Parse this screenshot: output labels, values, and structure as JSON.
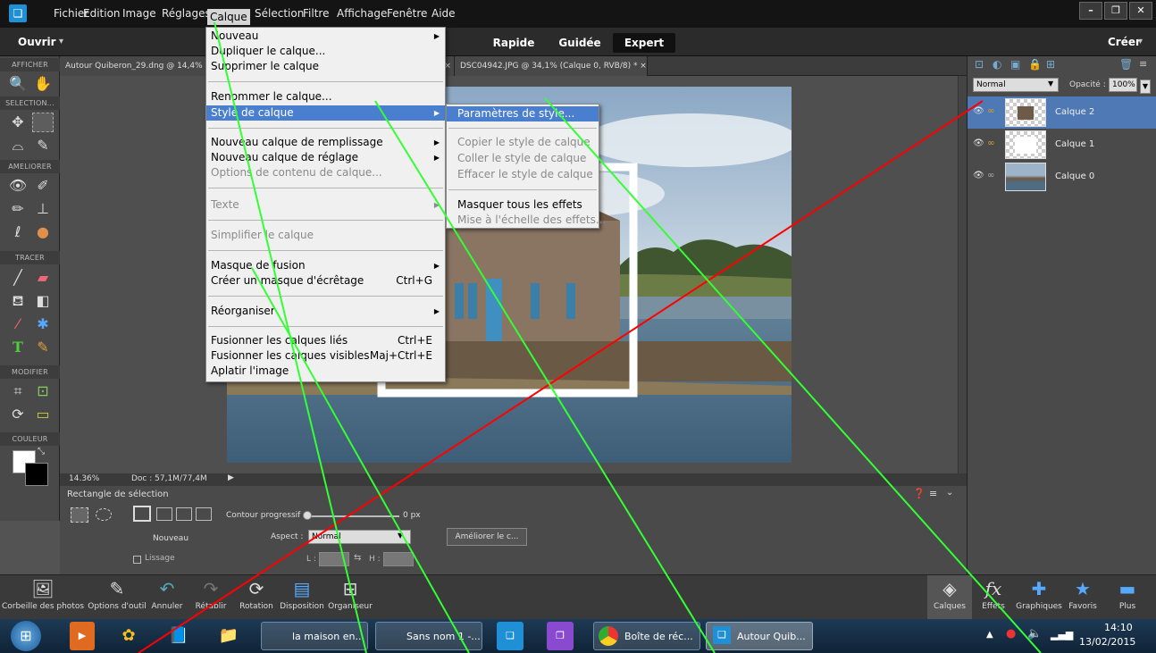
{
  "menubar": {
    "items": [
      "Fichier",
      "Edition",
      "Image",
      "Réglages",
      "Calque",
      "Sélection",
      "Filtre",
      "Affichage",
      "Fenêtre",
      "Aide"
    ],
    "window_controls": [
      "–",
      "❐",
      "✕"
    ]
  },
  "row2": {
    "open_label": "Ouvrir",
    "modes": [
      "Rapide",
      "Guidée",
      "Expert"
    ],
    "create_label": "Créer"
  },
  "toolbox": {
    "sections": [
      "AFFICHER",
      "SELECTION...",
      "AMELIORER",
      "TRACER",
      "MODIFIER",
      "COULEUR"
    ]
  },
  "tabs": [
    "Autour Quiberon_29.dng @ 14,4% (C",
    "* ×",
    "DSC04942.JPG @ 34,1% (Calque 0, RVB/8) * ×"
  ],
  "status": {
    "zoom": "14.36%",
    "doc": "Doc : 57,1M/77,4M"
  },
  "options": {
    "title": "Rectangle de sélection",
    "new_label": "Nouveau",
    "smooth_label": "Lissage",
    "feather_label": "Contour progressif :",
    "feather_value": "0 px",
    "aspect_label": "Aspect :",
    "aspect_value": "Normal",
    "refine_button": "Améliorer le c...",
    "l_label": "L :",
    "h_label": "H :"
  },
  "layers": {
    "blend_mode": "Normal",
    "opacity_label": "Opacité :",
    "opacity_value": "100%",
    "items": [
      {
        "name": "Calque 2"
      },
      {
        "name": "Calque 1"
      },
      {
        "name": "Calque 0"
      }
    ]
  },
  "calque_menu": {
    "items": [
      {
        "label": "Nouveau",
        "arrow": "▶",
        "disabled": false
      },
      {
        "label": "Dupliquer le calque...",
        "disabled": false
      },
      {
        "label": "Supprimer le calque",
        "disabled": false
      },
      {
        "label": "Renommer le calque...",
        "disabled": false
      },
      {
        "label": "Style de calque",
        "arrow": "▶",
        "highlighted": true
      },
      {
        "label": "Nouveau calque de remplissage",
        "arrow": "▶",
        "disabled": false
      },
      {
        "label": "Nouveau calque de réglage",
        "arrow": "▶",
        "disabled": false
      },
      {
        "label": "Options de contenu de calque...",
        "disabled": true
      },
      {
        "label": "Texte",
        "arrow": "▶",
        "disabled": true
      },
      {
        "label": "Simplifier le calque",
        "disabled": true
      },
      {
        "label": "Masque de fusion",
        "arrow": "▶",
        "disabled": false
      },
      {
        "label": "Créer un masque d'écrêtage",
        "shortcut": "Ctrl+G",
        "disabled": false
      },
      {
        "label": "Réorganiser",
        "arrow": "▶",
        "disabled": false
      },
      {
        "label": "Fusionner les calques liés",
        "shortcut": "Ctrl+E",
        "disabled": false
      },
      {
        "label": "Fusionner les calques visibles",
        "shortcut": "Maj+Ctrl+E",
        "disabled": false
      },
      {
        "label": "Aplatir l'image",
        "disabled": false
      }
    ]
  },
  "style_submenu": {
    "items": [
      {
        "label": "Paramètres de style...",
        "highlighted": true
      },
      {
        "label": "Copier le style de calque",
        "disabled": true
      },
      {
        "label": "Coller le style de calque",
        "disabled": true
      },
      {
        "label": "Effacer le style de calque",
        "disabled": true
      },
      {
        "label": "Masquer tous les effets",
        "disabled": false
      },
      {
        "label": "Mise à l'échelle des effets...",
        "disabled": true
      }
    ]
  },
  "bottom_panel": {
    "left": [
      "Corbeille des photos",
      "Options d'outil",
      "Annuler",
      "Rétablir",
      "Rotation",
      "Disposition",
      "Organiseur"
    ],
    "right": [
      "Calques",
      "Effets",
      "Graphiques",
      "Favoris",
      "Plus"
    ]
  },
  "taskbar": {
    "windows": [
      "la maison en...",
      "Sans nom 1 -...",
      "Boîte de réc...",
      "Autour Quib..."
    ],
    "time": "14:10",
    "date": "13/02/2015"
  },
  "colors": {
    "highlight": "#4a7fd0",
    "layer_selected": "#4f79b5",
    "annotation_green": "#33ff33",
    "annotation_red": "#ff0000"
  }
}
